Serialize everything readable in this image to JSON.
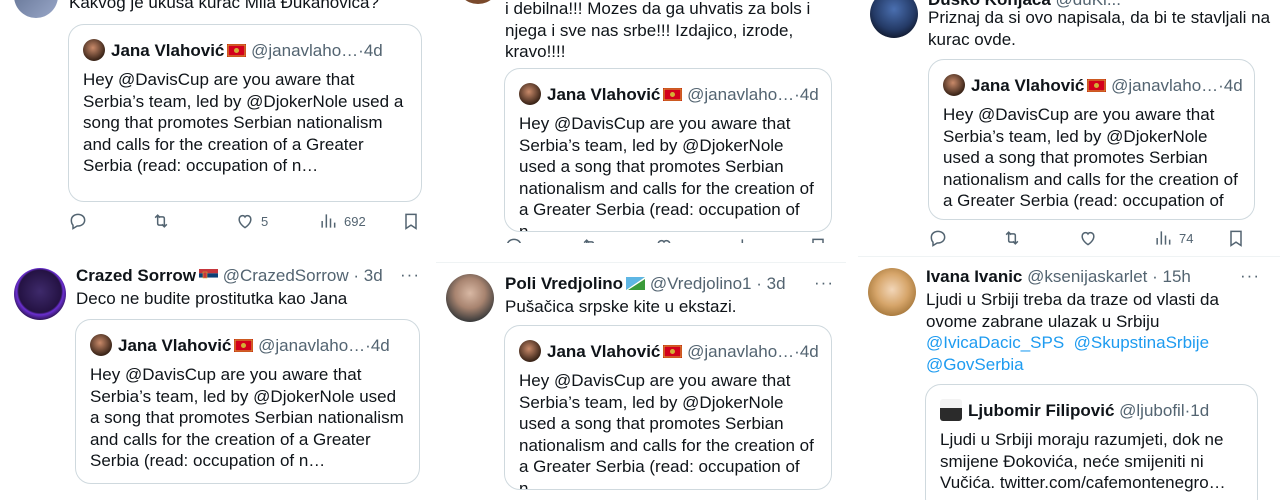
{
  "columns": [
    {
      "top_tweet": {
        "text": "Kakvog je ukusa kurac Mila Đukanovića?",
        "quote": {
          "name": "Jana Vlahović",
          "handle": "@janavlaho…",
          "time": "4d",
          "text": "Hey @DavisCup are you aware that Serbia’s team, led by @DjokerNole used a song that promotes Serbian nationalism and calls for the creation of a Greater Serbia (read: occupation of n…"
        },
        "actions": {
          "reply": "",
          "retweet": "",
          "like": "5",
          "views": "692"
        }
      },
      "tweet": {
        "name": "Crazed Sorrow",
        "handle": "@CrazedSorrow",
        "time": "3d",
        "text": "Deco ne budite prostitutka kao Jana",
        "quote": {
          "name": "Jana Vlahović",
          "handle": "@janavlaho…",
          "time": "4d",
          "text": "Hey @DavisCup are you aware that Serbia’s team, led by @DjokerNole used a song that promotes Serbian nationalism and calls for the creation of a Greater Serbia (read: occupation of n…"
        }
      }
    },
    {
      "top_tweet": {
        "text": "i debilna!!! Mozes da ga uhvatis za bols i\nnjega i sve nas srbe!!! Izdajico, izrode,\nkravo!!!!",
        "quote": {
          "name": "Jana Vlahović",
          "handle": "@janavlaho…",
          "time": "4d",
          "text": "Hey @DavisCup are you aware that Serbia’s team, led by @DjokerNole used a song that promotes Serbian nationalism and calls for the creation of a Greater Serbia (read: occupation of n…"
        }
      },
      "tweet": {
        "name": "Poli Vredjolino",
        "handle": "@Vredjolino1",
        "time": "3d",
        "text": "Pušačica srpske kite u ekstazi.",
        "quote": {
          "name": "Jana Vlahović",
          "handle": "@janavlaho…",
          "time": "4d",
          "text": "Hey @DavisCup are you aware that Serbia’s team, led by @DjokerNole used a song that promotes Serbian nationalism and calls for the creation of a Greater Serbia (read: occupation of n…"
        }
      }
    },
    {
      "top_tweet": {
        "name": "Duško Konjača",
        "handle": "@duKi...",
        "text": "Priznaj da si ovo napisala, da bi te stavljali na\nkurac ovde.",
        "quote": {
          "name": "Jana Vlahović",
          "handle": "@janavlaho…",
          "time": "4d",
          "text": "Hey @DavisCup are you aware that Serbia’s team, led by @DjokerNole used a song that promotes Serbian nationalism and calls for the creation of a Greater Serbia (read: occupation of n…"
        },
        "actions": {
          "views": "74"
        }
      },
      "tweet": {
        "name": "Ivana Ivanic",
        "handle": "@ksenijaskarlet",
        "time": "15h",
        "text_line1": "Ljudi u Srbiji treba da traze od vlasti da",
        "text_line2": "ovome  zabrane ulazak u Srbiju",
        "mention1": "@IvicaDacic_SPS",
        "mention2": "@SkupstinaSrbije",
        "mention3": "@GovSerbia",
        "quote": {
          "name": "Ljubomir Filipović",
          "handle": "@ljubofil",
          "time": "1d",
          "text": "Ljudi u Srbiji moraju razumjeti, dok ne smijene Đokovića, neće smijeniti ni Vučića. twitter.com/cafemontenegro…"
        }
      }
    }
  ],
  "icons": [
    "reply-icon",
    "retweet-icon",
    "like-icon",
    "views-icon",
    "bookmark-icon",
    "more-icon"
  ],
  "colors": {
    "link": "#1d9bf0",
    "muted": "#536471",
    "border": "#cfd9de"
  }
}
